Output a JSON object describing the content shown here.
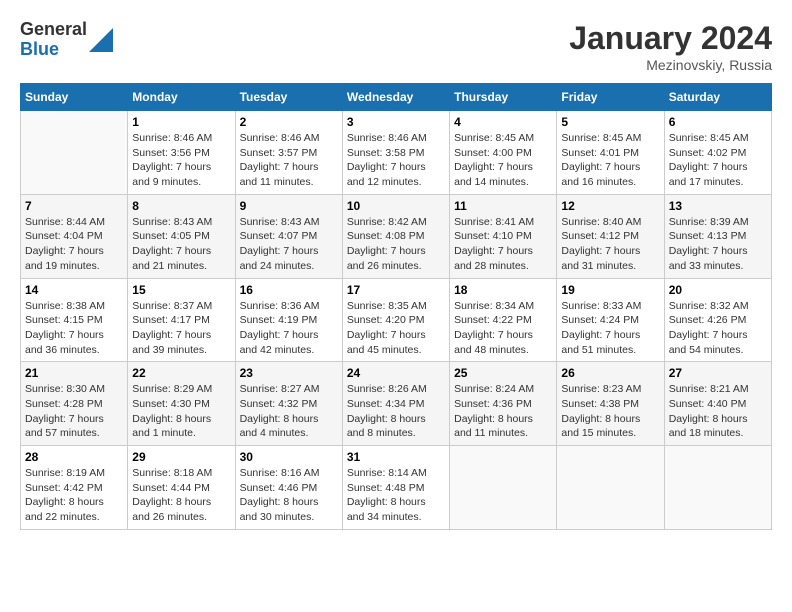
{
  "logo": {
    "general": "General",
    "blue": "Blue"
  },
  "title": {
    "month": "January 2024",
    "location": "Mezinovskiy, Russia"
  },
  "weekdays": [
    "Sunday",
    "Monday",
    "Tuesday",
    "Wednesday",
    "Thursday",
    "Friday",
    "Saturday"
  ],
  "weeks": [
    [
      {
        "day": "",
        "info": ""
      },
      {
        "day": "1",
        "info": "Sunrise: 8:46 AM\nSunset: 3:56 PM\nDaylight: 7 hours\nand 9 minutes."
      },
      {
        "day": "2",
        "info": "Sunrise: 8:46 AM\nSunset: 3:57 PM\nDaylight: 7 hours\nand 11 minutes."
      },
      {
        "day": "3",
        "info": "Sunrise: 8:46 AM\nSunset: 3:58 PM\nDaylight: 7 hours\nand 12 minutes."
      },
      {
        "day": "4",
        "info": "Sunrise: 8:45 AM\nSunset: 4:00 PM\nDaylight: 7 hours\nand 14 minutes."
      },
      {
        "day": "5",
        "info": "Sunrise: 8:45 AM\nSunset: 4:01 PM\nDaylight: 7 hours\nand 16 minutes."
      },
      {
        "day": "6",
        "info": "Sunrise: 8:45 AM\nSunset: 4:02 PM\nDaylight: 7 hours\nand 17 minutes."
      }
    ],
    [
      {
        "day": "7",
        "info": "Sunrise: 8:44 AM\nSunset: 4:04 PM\nDaylight: 7 hours\nand 19 minutes."
      },
      {
        "day": "8",
        "info": "Sunrise: 8:43 AM\nSunset: 4:05 PM\nDaylight: 7 hours\nand 21 minutes."
      },
      {
        "day": "9",
        "info": "Sunrise: 8:43 AM\nSunset: 4:07 PM\nDaylight: 7 hours\nand 24 minutes."
      },
      {
        "day": "10",
        "info": "Sunrise: 8:42 AM\nSunset: 4:08 PM\nDaylight: 7 hours\nand 26 minutes."
      },
      {
        "day": "11",
        "info": "Sunrise: 8:41 AM\nSunset: 4:10 PM\nDaylight: 7 hours\nand 28 minutes."
      },
      {
        "day": "12",
        "info": "Sunrise: 8:40 AM\nSunset: 4:12 PM\nDaylight: 7 hours\nand 31 minutes."
      },
      {
        "day": "13",
        "info": "Sunrise: 8:39 AM\nSunset: 4:13 PM\nDaylight: 7 hours\nand 33 minutes."
      }
    ],
    [
      {
        "day": "14",
        "info": "Sunrise: 8:38 AM\nSunset: 4:15 PM\nDaylight: 7 hours\nand 36 minutes."
      },
      {
        "day": "15",
        "info": "Sunrise: 8:37 AM\nSunset: 4:17 PM\nDaylight: 7 hours\nand 39 minutes."
      },
      {
        "day": "16",
        "info": "Sunrise: 8:36 AM\nSunset: 4:19 PM\nDaylight: 7 hours\nand 42 minutes."
      },
      {
        "day": "17",
        "info": "Sunrise: 8:35 AM\nSunset: 4:20 PM\nDaylight: 7 hours\nand 45 minutes."
      },
      {
        "day": "18",
        "info": "Sunrise: 8:34 AM\nSunset: 4:22 PM\nDaylight: 7 hours\nand 48 minutes."
      },
      {
        "day": "19",
        "info": "Sunrise: 8:33 AM\nSunset: 4:24 PM\nDaylight: 7 hours\nand 51 minutes."
      },
      {
        "day": "20",
        "info": "Sunrise: 8:32 AM\nSunset: 4:26 PM\nDaylight: 7 hours\nand 54 minutes."
      }
    ],
    [
      {
        "day": "21",
        "info": "Sunrise: 8:30 AM\nSunset: 4:28 PM\nDaylight: 7 hours\nand 57 minutes."
      },
      {
        "day": "22",
        "info": "Sunrise: 8:29 AM\nSunset: 4:30 PM\nDaylight: 8 hours\nand 1 minute."
      },
      {
        "day": "23",
        "info": "Sunrise: 8:27 AM\nSunset: 4:32 PM\nDaylight: 8 hours\nand 4 minutes."
      },
      {
        "day": "24",
        "info": "Sunrise: 8:26 AM\nSunset: 4:34 PM\nDaylight: 8 hours\nand 8 minutes."
      },
      {
        "day": "25",
        "info": "Sunrise: 8:24 AM\nSunset: 4:36 PM\nDaylight: 8 hours\nand 11 minutes."
      },
      {
        "day": "26",
        "info": "Sunrise: 8:23 AM\nSunset: 4:38 PM\nDaylight: 8 hours\nand 15 minutes."
      },
      {
        "day": "27",
        "info": "Sunrise: 8:21 AM\nSunset: 4:40 PM\nDaylight: 8 hours\nand 18 minutes."
      }
    ],
    [
      {
        "day": "28",
        "info": "Sunrise: 8:19 AM\nSunset: 4:42 PM\nDaylight: 8 hours\nand 22 minutes."
      },
      {
        "day": "29",
        "info": "Sunrise: 8:18 AM\nSunset: 4:44 PM\nDaylight: 8 hours\nand 26 minutes."
      },
      {
        "day": "30",
        "info": "Sunrise: 8:16 AM\nSunset: 4:46 PM\nDaylight: 8 hours\nand 30 minutes."
      },
      {
        "day": "31",
        "info": "Sunrise: 8:14 AM\nSunset: 4:48 PM\nDaylight: 8 hours\nand 34 minutes."
      },
      {
        "day": "",
        "info": ""
      },
      {
        "day": "",
        "info": ""
      },
      {
        "day": "",
        "info": ""
      }
    ]
  ]
}
